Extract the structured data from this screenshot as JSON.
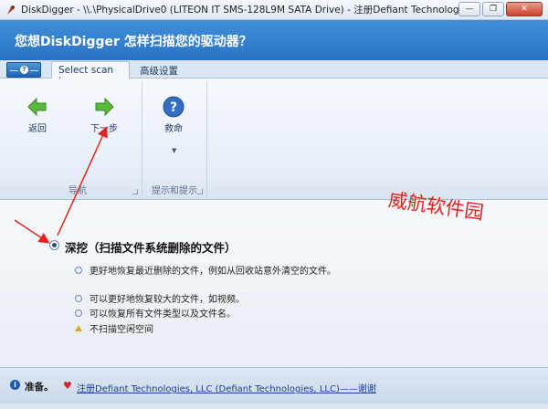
{
  "window": {
    "title": "DiskDigger - \\\\.\\PhysicalDrive0 (LITEON IT SMS-128L9M SATA Drive) - 注册Defiant Technologies, LLC (Defi...",
    "minimize_glyph": "—",
    "restore_glyph": "❐",
    "close_glyph": "✕"
  },
  "banner": {
    "heading": "您想DiskDigger 怎样扫描您的驱动器？"
  },
  "ribbon": {
    "tabs": [
      {
        "label": "Select scan type",
        "active": true
      },
      {
        "label": "高级设置",
        "active": false
      }
    ],
    "groups": [
      {
        "label": "导航",
        "buttons": [
          {
            "label": "返回",
            "icon": "back-arrow-icon"
          },
          {
            "label": "下一步",
            "icon": "next-arrow-icon"
          }
        ]
      },
      {
        "label": "提示和提示",
        "buttons": [
          {
            "label": "救命",
            "icon": "help-icon"
          }
        ]
      }
    ]
  },
  "scan_option": {
    "title": "深挖（扫描文件系统删除的文件）",
    "selected": true,
    "bullets": [
      {
        "text": "更好地恢复最近删除的文件，例如从回收站意外清空的文件。",
        "icon": "plus-icon"
      },
      {
        "text": "可以更好地恢复较大的文件，如视频。",
        "icon": "plus-icon"
      },
      {
        "text": "可以恢复所有文件类型以及文件名。",
        "icon": "plus-icon"
      },
      {
        "text": "不扫描空闲空间",
        "icon": "warning-icon"
      }
    ]
  },
  "watermark": "威航软件园",
  "status": {
    "ready": "准备。",
    "link": "注册Defiant Technologies, LLC (Defiant Technologies, LLC)——谢谢"
  },
  "colors": {
    "banner": "#2f7fd0",
    "annotation_arrow": "#e2231a",
    "link": "#1c3f9a"
  }
}
